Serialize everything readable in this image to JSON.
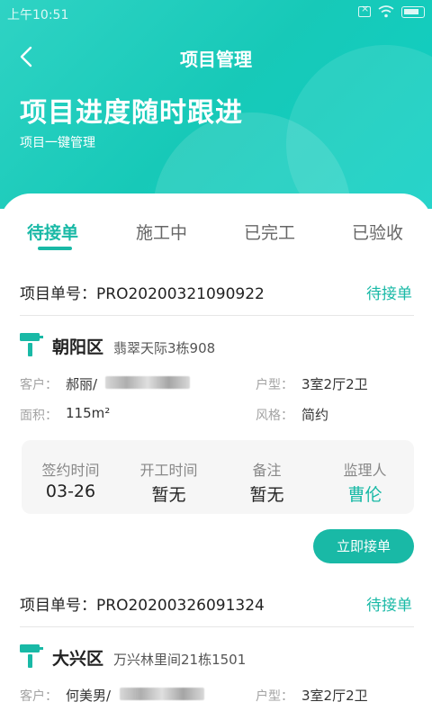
{
  "status_bar": {
    "time": "上午10:51"
  },
  "nav": {
    "title": "项目管理"
  },
  "hero": {
    "title": "项目进度随时跟进",
    "subtitle": "项目一键管理"
  },
  "tabs": [
    {
      "label": "待接单",
      "active": true
    },
    {
      "label": "施工中",
      "active": false
    },
    {
      "label": "已完工",
      "active": false
    },
    {
      "label": "已验收",
      "active": false
    }
  ],
  "labels": {
    "order_no_prefix": "项目单号：",
    "customer": "客户：",
    "area": "面积：",
    "layout": "户型：",
    "style": "风格：",
    "sign_time": "签约时间",
    "start_time": "开工时间",
    "remark": "备注",
    "supervisor": "监理人"
  },
  "orders": [
    {
      "order_no": "PRO20200321090922",
      "status": "待接单",
      "district": "朝阳区",
      "address": "翡翠天际3栋908",
      "customer_name": "郝丽/",
      "area": "115m²",
      "layout": "3室2厅2卫",
      "style": "简约",
      "sign_time": "03-26",
      "start_time": "暂无",
      "remark": "暂无",
      "supervisor": "曹伦",
      "action_label": "立即接单"
    },
    {
      "order_no": "PRO20200326091324",
      "status": "待接单",
      "district": "大兴区",
      "address": "万兴林里间21栋1501",
      "customer_name": "何美男/",
      "layout": "3室2厅2卫"
    }
  ],
  "colors": {
    "accent": "#19b9a6",
    "hero_start": "#2fd3c4",
    "hero_end": "#0fd0c4"
  },
  "icons": {
    "back": "chevron-left-icon",
    "location": "paint-roller-icon"
  }
}
